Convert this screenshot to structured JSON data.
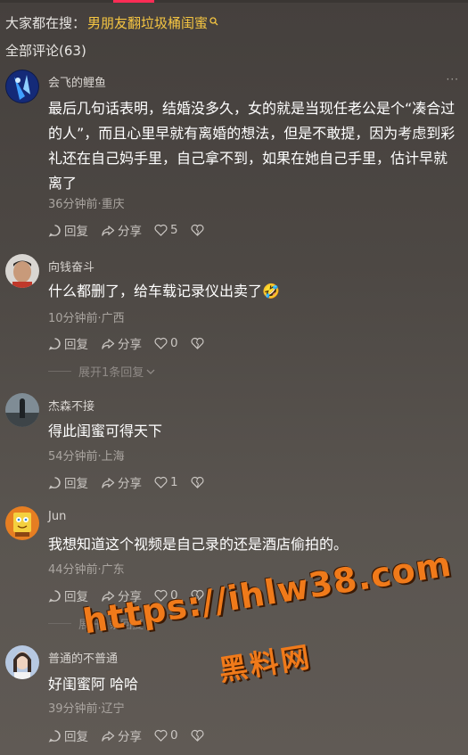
{
  "hot_search": {
    "label": "大家都在搜：",
    "term": "男朋友翻垃圾桶闺蜜"
  },
  "comments_total": "全部评论(63)",
  "comments": [
    {
      "username": "会飞的鲤鱼",
      "text": "最后几句话表明，结婚没多久，女的就是当现任老公是个“凑合过的人”，而且心里早就有离婚的想法，但是不敢提，因为考虑到彩礼还在自己妈手里，自己拿不到，如果在她自己手里，估计早就离了",
      "meta": "36分钟前·重庆",
      "reply": "回复",
      "share": "分享",
      "likes": "5"
    },
    {
      "username": "向钱奋斗",
      "text": "什么都删了，给车载记录仪出卖了🤣",
      "meta": "10分钟前·广西",
      "reply": "回复",
      "share": "分享",
      "likes": "0",
      "expand": "展开1条回复"
    },
    {
      "username": "杰森不接",
      "text": "得此闺蜜可得天下",
      "meta": "54分钟前·上海",
      "reply": "回复",
      "share": "分享",
      "likes": "1"
    },
    {
      "username": "Jun",
      "text": "我想知道这个视频是自己录的还是酒店偷拍的。",
      "meta": "44分钟前·广东",
      "reply": "回复",
      "share": "分享",
      "likes": "0",
      "expand": "展开1条回复"
    },
    {
      "username": "普通的不普通",
      "text": "好闺蜜阿 哈哈",
      "meta": "39分钟前·辽宁",
      "reply": "回复",
      "share": "分享",
      "likes": "0"
    }
  ],
  "watermark": {
    "url": "https://ihlw38.com",
    "text": "黑料网"
  },
  "colors": {
    "accent": "#fe2c55",
    "hot_term": "#f5c542",
    "watermark": "#f07a1a"
  }
}
